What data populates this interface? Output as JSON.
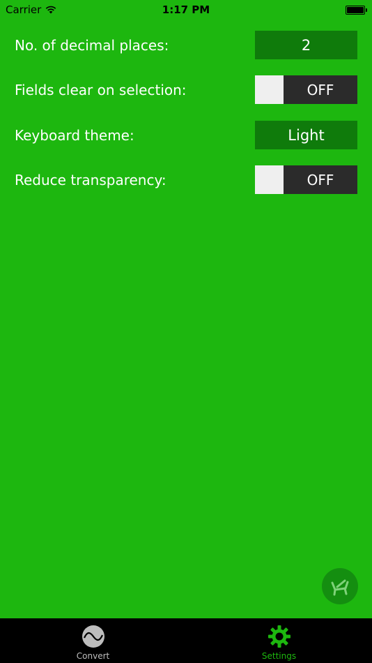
{
  "status_bar": {
    "carrier": "Carrier",
    "time": "1:17 PM"
  },
  "settings": [
    {
      "label": "No. of decimal places:",
      "control_type": "value",
      "value": "2"
    },
    {
      "label": "Fields clear on selection:",
      "control_type": "toggle",
      "value": "OFF"
    },
    {
      "label": "Keyboard theme:",
      "control_type": "value",
      "value": "Light"
    },
    {
      "label": "Reduce transparency:",
      "control_type": "toggle",
      "value": "OFF"
    }
  ],
  "fab": {
    "icon": "recliner-icon"
  },
  "tabs": [
    {
      "label": "Convert",
      "icon": "wave-icon",
      "selected": false
    },
    {
      "label": "Settings",
      "icon": "gear-icon",
      "selected": true
    }
  ],
  "colors": {
    "background": "#1db70f",
    "value_button": "#0f7b0b",
    "toggle_off": "#2b2b2b",
    "tab_selected": "#1db70f",
    "tab_unselected": "#bdbdbd"
  }
}
